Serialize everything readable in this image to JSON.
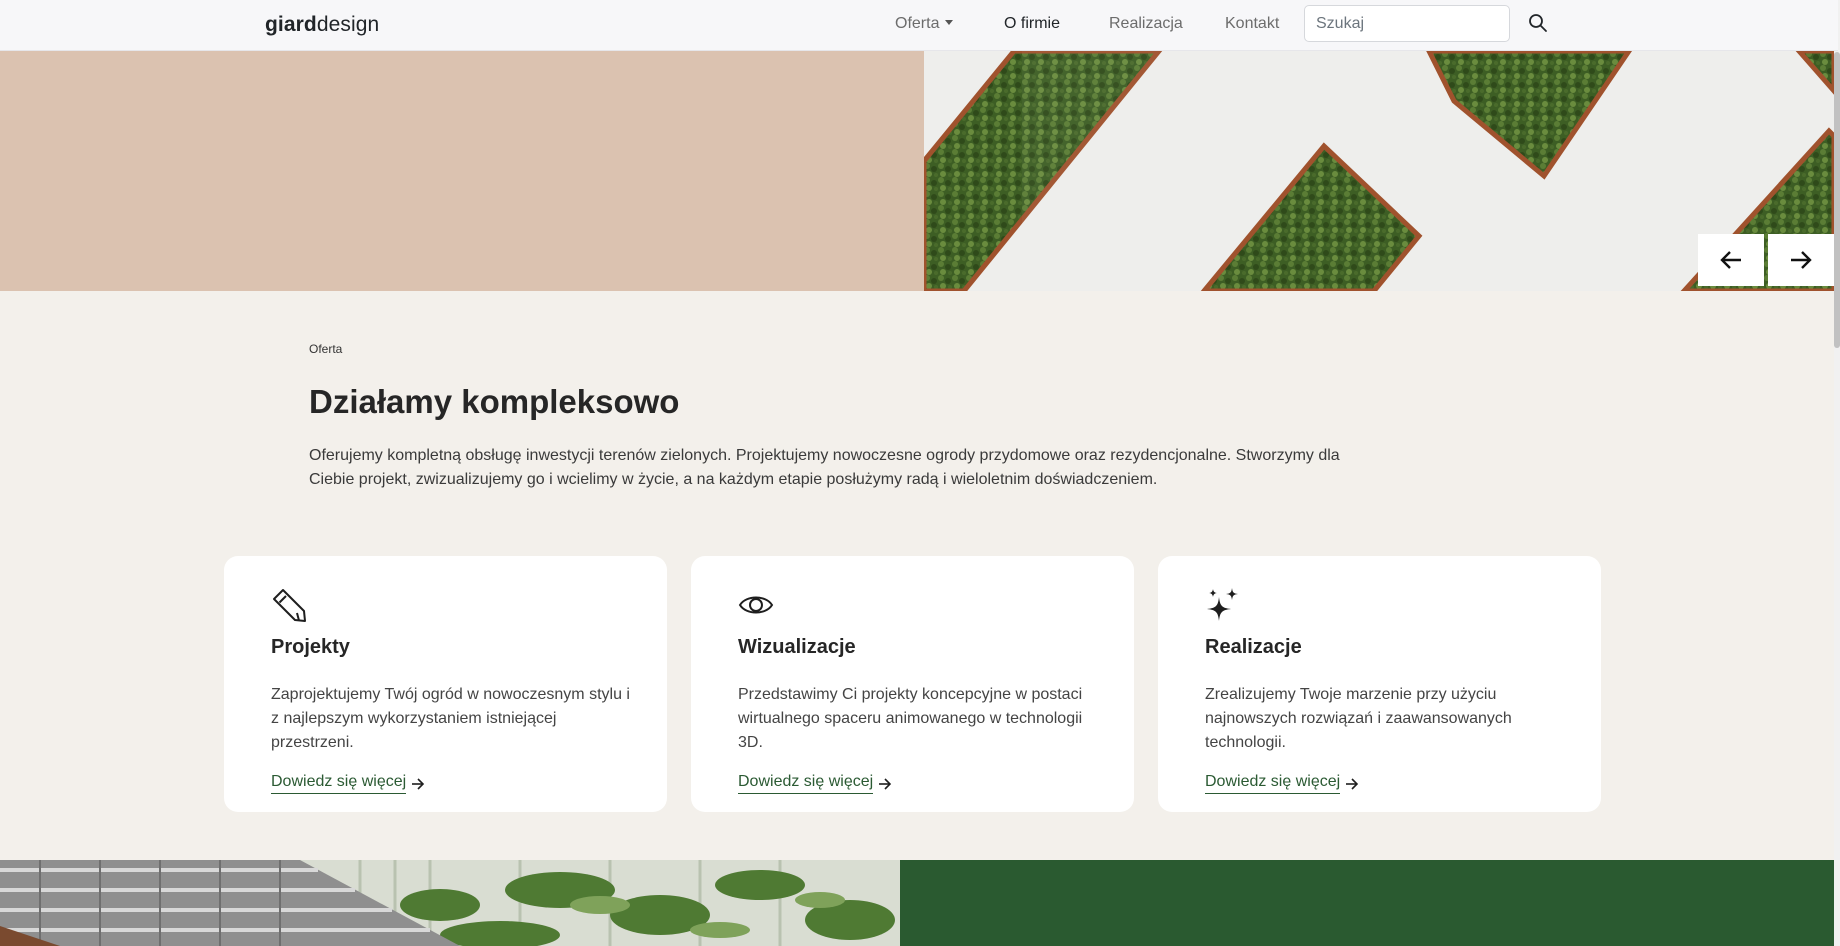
{
  "nav": {
    "brand_bold": "giard",
    "brand_light": "design",
    "links": [
      {
        "label": "Oferta",
        "dropdown": true
      },
      {
        "label": "O firmie",
        "active": true
      },
      {
        "label": "Realizacja"
      },
      {
        "label": "Kontakt"
      }
    ],
    "search_placeholder": "Szukaj",
    "search_icon": "search-icon"
  },
  "hero": {
    "left_color": "#dbc2b0",
    "prev_icon": "arrow-left-icon",
    "next_icon": "arrow-right-icon"
  },
  "section": {
    "eyebrow": "Oferta",
    "title": "Działamy kompleksowo",
    "lead": "Oferujemy kompletną obsługę inwestycji terenów zielonych. Projektujemy nowoczesne ogrody przydomowe oraz rezydencjonalne. Stworzymy dla Ciebie projekt, zwizualizujemy go i wcielimy w życie, a na każdym etapie posłużymy radą i wieloletnim doświadczeniem."
  },
  "cards": [
    {
      "icon": "pencil-icon",
      "title": "Projekty",
      "text": "Zaprojektujemy Twój ogród w nowoczesnym stylu i z najlepszym wykorzystaniem istniejącej przestrzeni.",
      "link": "Dowiedz się więcej"
    },
    {
      "icon": "eye-icon",
      "title": "Wizualizacje",
      "text": "Przedstawimy Ci projekty koncepcyjne w postaci wirtualnego spaceru animowanego w technologii 3D.",
      "link": "Dowiedz się więcej"
    },
    {
      "icon": "sparkles-icon",
      "title": "Realizacje",
      "text": "Zrealizujemy Twoje marzenie przy użyciu najnowszych rozwiązań i zaawansowanych technologii.",
      "link": "Dowiedz się więcej"
    }
  ],
  "colors": {
    "accent_green": "#2b5a33",
    "page_bg": "#f3f0eb",
    "bottom_green": "#2a5a30"
  }
}
